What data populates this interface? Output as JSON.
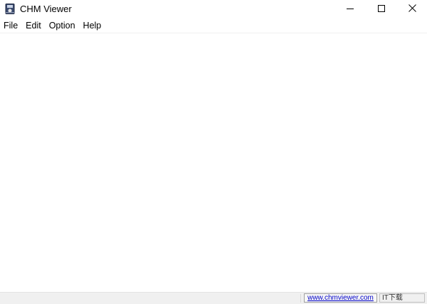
{
  "window": {
    "title": "CHM Viewer",
    "app_icon": "chm-book-icon",
    "controls": {
      "minimize_icon": "minimize-icon",
      "maximize_icon": "maximize-icon",
      "close_icon": "close-icon"
    }
  },
  "menubar": {
    "items": [
      {
        "label": "File"
      },
      {
        "label": "Edit"
      },
      {
        "label": "Option"
      },
      {
        "label": "Help"
      }
    ]
  },
  "statusbar": {
    "main_text": "",
    "link_text": "www.chmviewer.com",
    "tail_text": "IT下载"
  },
  "colors": {
    "window_bg": "#ffffff",
    "statusbar_bg": "#f0f0f0",
    "link": "#0000c8"
  }
}
